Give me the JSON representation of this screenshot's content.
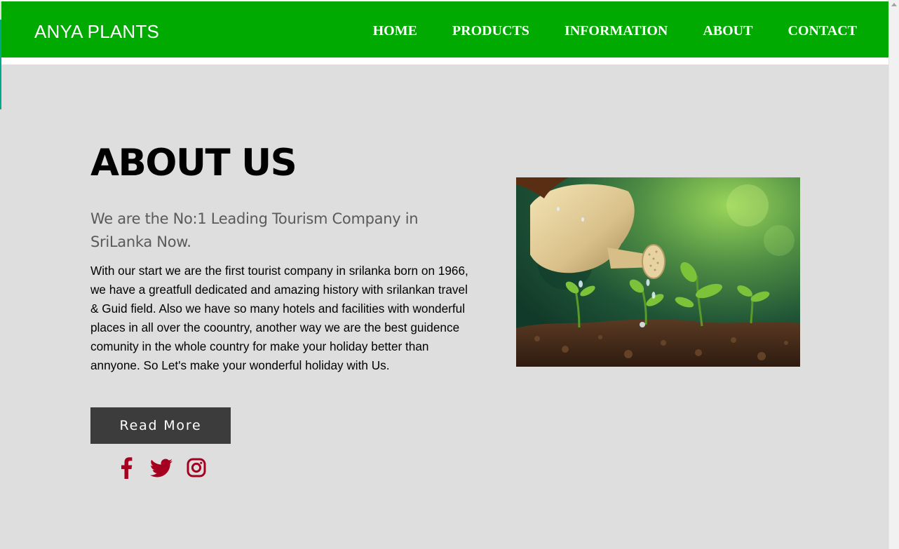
{
  "brand": "ANYA PLANTS",
  "nav": {
    "items": [
      "HOME",
      "PRODUCTS",
      "INFORMATION",
      "ABOUT",
      "CONTACT"
    ]
  },
  "about": {
    "title": "ABOUT US",
    "subtitle": "We are the No:1 Leading Tourism Company in SriLanka Now.",
    "body": "With our start we are the first tourist company in srilanka born on 1966, we have a greatfull dedicated and amazing history with srilankan travel & Guid field. Also we have so many hotels and facilities with wonderful places in all over the coountry, another way we are the best guidence comunity in the whole country for make your holiday better than annyone. So Let's make your wonderful holiday with Us.",
    "button_label": "Read More"
  },
  "socials": [
    {
      "icon": "facebook-icon"
    },
    {
      "icon": "twitter-icon"
    },
    {
      "icon": "instagram-icon"
    }
  ],
  "colors": {
    "navbar": "#00aa00",
    "background": "#dedede",
    "button": "#3c3c3c",
    "social": "#a5001f"
  }
}
